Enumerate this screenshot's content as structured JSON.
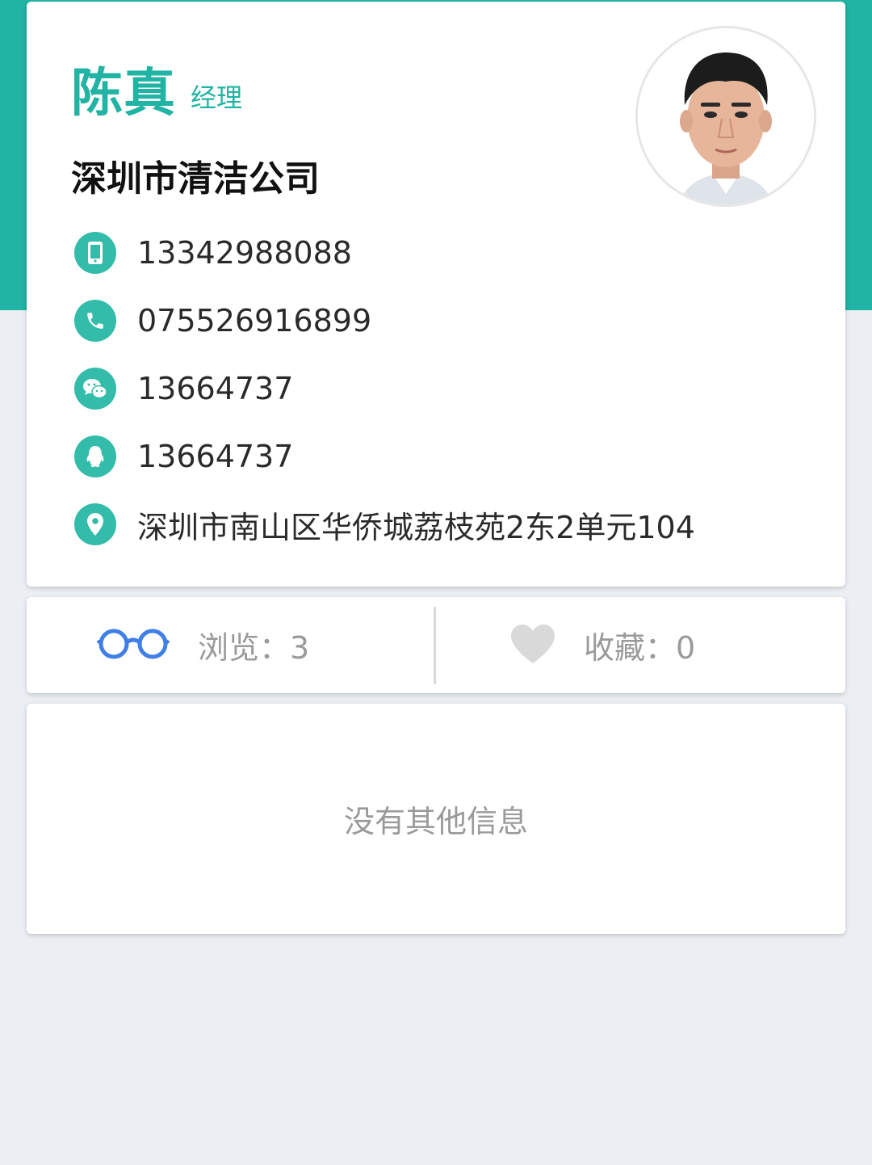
{
  "profile": {
    "name": "陈真",
    "role": "经理",
    "company": "深圳市清洁公司",
    "avatar_icon": "person-photo",
    "accent_color": "#21b3a3"
  },
  "contacts": {
    "mobile": {
      "icon": "mobile-phone-icon",
      "value": "13342988088"
    },
    "phone": {
      "icon": "telephone-icon",
      "value": "075526916899"
    },
    "wechat": {
      "icon": "wechat-icon",
      "value": "13664737"
    },
    "qq": {
      "icon": "qq-icon",
      "value": "13664737"
    },
    "address": {
      "icon": "location-pin-icon",
      "value": "深圳市南山区华侨城荔枝苑2东2单元104"
    }
  },
  "stats": {
    "views_label": "浏览：3",
    "favorites_label": "收藏：0",
    "views_icon_color": "#3f7fe6",
    "favorites_icon_color": "#d9d9d9"
  },
  "other": {
    "empty_text": "没有其他信息"
  }
}
